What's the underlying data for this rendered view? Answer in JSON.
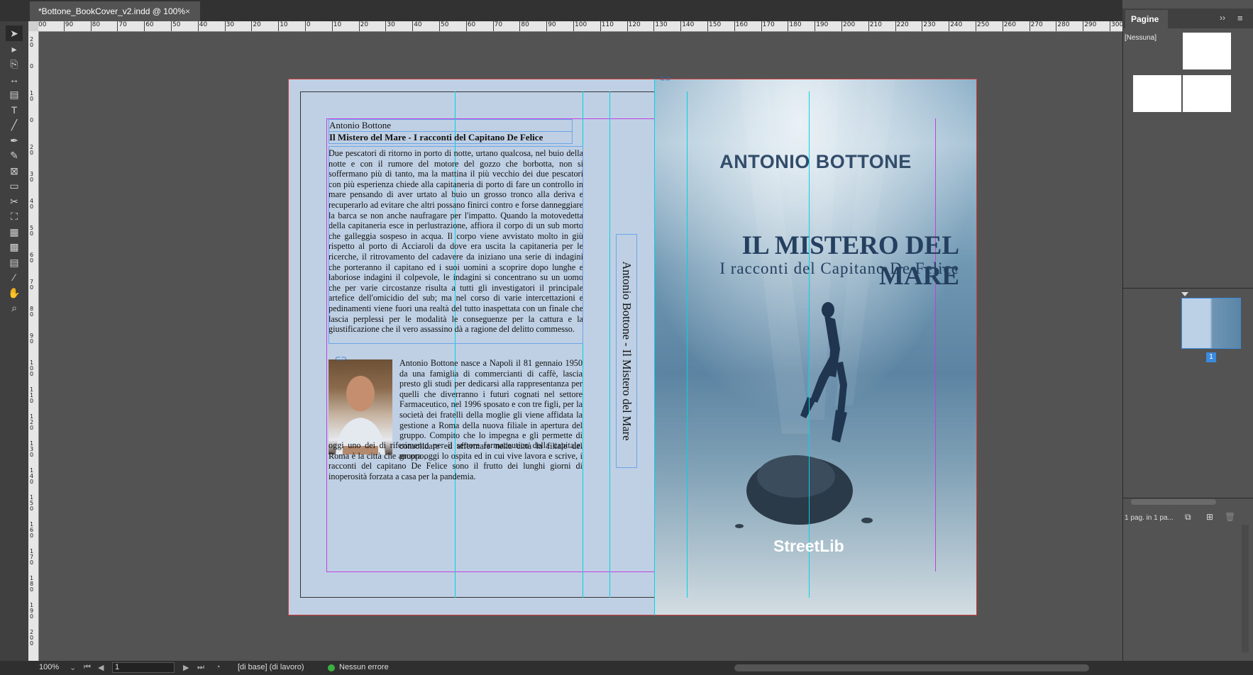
{
  "document": {
    "tab_title": "*Bottone_BookCover_v2.indd @ 100%",
    "close_glyph": "×"
  },
  "ruler": {
    "top_labels": [
      "00",
      "90",
      "80",
      "70",
      "60",
      "50",
      "40",
      "30",
      "20",
      "10",
      "0",
      "10",
      "20",
      "30",
      "40",
      "50",
      "60",
      "70",
      "80",
      "90",
      "100",
      "110",
      "120",
      "130",
      "140",
      "150",
      "160",
      "170",
      "180",
      "190",
      "200",
      "210",
      "220",
      "230",
      "240",
      "250",
      "260",
      "270",
      "280",
      "290",
      "300"
    ],
    "left_labels": [
      "2\n0",
      "0",
      "1\n0",
      "0",
      "2\n0",
      "3\n0",
      "4\n0",
      "5\n0",
      "6\n0",
      "7\n0",
      "8\n0",
      "9\n0",
      "1\n0\n0",
      "1\n1\n0",
      "1\n2\n0",
      "1\n3\n0",
      "1\n4\n0",
      "1\n5\n0",
      "1\n6\n0",
      "1\n7\n0",
      "1\n8\n0",
      "1\n9\n0",
      "2\n0\n0"
    ]
  },
  "toolbar": {
    "tools": [
      {
        "name": "selection-tool-icon",
        "glyph": "➤"
      },
      {
        "name": "direct-selection-tool-icon",
        "glyph": "▸"
      },
      {
        "name": "page-tool-icon",
        "glyph": "⎘"
      },
      {
        "name": "gap-tool-icon",
        "glyph": "↔"
      },
      {
        "name": "content-collector-tool-icon",
        "glyph": "▤"
      },
      {
        "name": "type-tool-icon",
        "glyph": "T"
      },
      {
        "name": "line-tool-icon",
        "glyph": "╱"
      },
      {
        "name": "pen-tool-icon",
        "glyph": "✒"
      },
      {
        "name": "pencil-tool-icon",
        "glyph": "✎"
      },
      {
        "name": "rectangle-frame-tool-icon",
        "glyph": "⊠"
      },
      {
        "name": "rectangle-tool-icon",
        "glyph": "▭"
      },
      {
        "name": "scissors-tool-icon",
        "glyph": "✂"
      },
      {
        "name": "free-transform-tool-icon",
        "glyph": "⛶"
      },
      {
        "name": "gradient-swatch-tool-icon",
        "glyph": "▦"
      },
      {
        "name": "gradient-feather-tool-icon",
        "glyph": "▩"
      },
      {
        "name": "note-tool-icon",
        "glyph": "▤"
      },
      {
        "name": "eyedropper-tool-icon",
        "glyph": "⁄"
      },
      {
        "name": "hand-tool-icon",
        "glyph": "✋"
      },
      {
        "name": "zoom-tool-icon",
        "glyph": "⌕"
      }
    ]
  },
  "panel": {
    "title": "Pagine",
    "none_label": "[Nessuna]",
    "page_number": "1",
    "footer_label": "1 pag. in 1 pa...",
    "menu_glyph": "≡",
    "collapse_glyph": "››"
  },
  "status": {
    "zoom": "100%",
    "page_field": "1",
    "master": "[di base] (di lavoro)",
    "preflight": "Nessun errore"
  },
  "back_cover": {
    "author_small": "Antonio Bottone",
    "title_small": "Il Mistero del Mare - I racconti del Capitano De Felice",
    "synopsis": "Due pescatori di ritorno in porto di notte, urtano qualcosa, nel buio della notte e con il rumore del motore del gozzo che borbotta, non si soffermano più di tanto, ma la mattina il più vecchio dei due pescatori con più esperienza chiede alla capitaneria di porto di fare un controllo in mare pensando di aver urtato al buio un grosso tronco alla deriva e recuperarlo ad evitare che altri possano finirci contro e forse danneggiare la barca se non anche naufragare per l'impatto. Quando la motovedetta della capitaneria esce in perlustrazione, affiora il corpo di un sub morto che galleggia sospeso in acqua. Il corpo viene avvistato molto in giù rispetto al porto di Acciaroli da dove era uscita la capitaneria per le ricerche, il ritrovamento del cadavere da iniziano una serie di indagini che porteranno il capitano ed i suoi uomini a scoprire dopo lunghe e laboriose indagini il colpevole, le indagini si concentrano su un uomo che per varie circostanze risulta a tutti gli investigatori il principale artefice dell'omicidio del sub; ma nel corso di varie intercettazioni e pedinamenti viene fuori una realtà del tutto inaspettata con un finale che lascia perplessi per le modalità le conseguenze per la cattura e la giustificazione che il vero assassino dà a ragione del delitto commesso.",
    "bio_part1": "Antonio Bottone nasce a Napoli il 81 gennaio 1950 da una famiglia di commercianti di caffè, lascia presto gli studi per dedicarsi alla rappresentanza per quelli che diverranno i futuri cognati nel settore Farmaceutico, nel 1996 sposato e con tre figli, per la società dei fratelli della moglie gli viene affidata la gestione a Roma della nuova filiale in apertura del gruppo. Compito che lo impegna e gli permette di consolidare ed affermare nella città la filiale del gruppo,",
    "bio_part2": "oggi uno dei di riferimento per il settore farmaceutico della capitale. Roma è la città che ancora oggi lo ospita ed in cui vive lavora e scrive, i racconti del capitano De Felice sono il frutto dei lunghi giorni di inoperosità forzata a casa per la pandemia."
  },
  "spine": {
    "text": "Antonio Bottone - Il Mistero del Mare"
  },
  "front_cover": {
    "author": "ANTONIO BOTTONE",
    "title": "IL MISTERO DEL MARE",
    "subtitle": "I racconti del Capitano De Felice",
    "publisher": "StreetLib"
  }
}
